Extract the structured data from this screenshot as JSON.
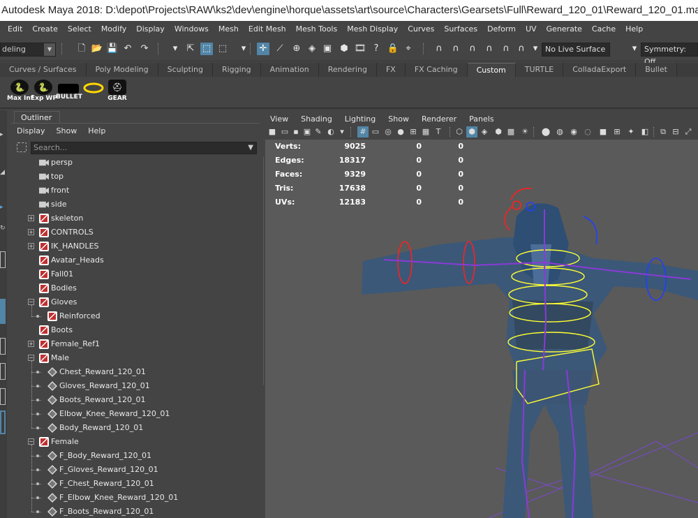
{
  "window": {
    "title": "Autodesk Maya 2018: D:\\depot\\Projects\\RAW\\ks2\\dev\\engine\\horque\\assets\\art\\source\\Characters\\Gearsets\\Full\\Reward_120_01\\Reward_120_01.ma*"
  },
  "menubar": [
    "Edit",
    "Create",
    "Select",
    "Modify",
    "Display",
    "Windows",
    "Mesh",
    "Edit Mesh",
    "Mesh Tools",
    "Mesh Display",
    "Curves",
    "Surfaces",
    "Deform",
    "UV",
    "Generate",
    "Cache",
    "Help"
  ],
  "statusline": {
    "mode": "deling",
    "live_surface": "No Live Surface",
    "symmetry": "Symmetry: Off"
  },
  "shelf_tabs": [
    "Curves / Surfaces",
    "Poly Modeling",
    "Sculpting",
    "Rigging",
    "Animation",
    "Rendering",
    "FX",
    "FX Caching",
    "Custom",
    "TURTLE",
    "ColladaExport",
    "Bullet"
  ],
  "shelf_active": "Custom",
  "shelf_buttons": [
    {
      "label": "Max Inf",
      "icon": "python-icon"
    },
    {
      "label": "Exp WP",
      "icon": "python-icon"
    },
    {
      "label": "BULLET",
      "icon": "bullet-icon"
    },
    {
      "label": "",
      "icon": "halo-icon"
    },
    {
      "label": "GEAR",
      "icon": "gear-helmet-icon"
    }
  ],
  "outliner": {
    "tab": "Outliner",
    "menu": [
      "Display",
      "Show",
      "Help"
    ],
    "search_placeholder": "Search...",
    "items": [
      {
        "label": "persp",
        "type": "camera",
        "depth": 0,
        "expander": ""
      },
      {
        "label": "top",
        "type": "camera",
        "depth": 0,
        "expander": ""
      },
      {
        "label": "front",
        "type": "camera",
        "depth": 0,
        "expander": ""
      },
      {
        "label": "side",
        "type": "camera",
        "depth": 0,
        "expander": ""
      },
      {
        "label": "skeleton",
        "type": "set",
        "depth": 0,
        "expander": "+"
      },
      {
        "label": "CONTROLS",
        "type": "set",
        "depth": 0,
        "expander": "+"
      },
      {
        "label": "IK_HANDLES",
        "type": "set",
        "depth": 0,
        "expander": "+"
      },
      {
        "label": "Avatar_Heads",
        "type": "set",
        "depth": 0,
        "expander": ""
      },
      {
        "label": "Fall01",
        "type": "set",
        "depth": 0,
        "expander": ""
      },
      {
        "label": "Bodies",
        "type": "set",
        "depth": 0,
        "expander": ""
      },
      {
        "label": "Gloves",
        "type": "set",
        "depth": 0,
        "expander": "-"
      },
      {
        "label": "Reinforced",
        "type": "set",
        "depth": 1,
        "expander": ""
      },
      {
        "label": "Boots",
        "type": "set",
        "depth": 0,
        "expander": ""
      },
      {
        "label": "Female_Ref1",
        "type": "set",
        "depth": 0,
        "expander": "+"
      },
      {
        "label": "Male",
        "type": "set",
        "depth": 0,
        "expander": "-"
      },
      {
        "label": "Chest_Reward_120_01",
        "type": "mesh",
        "depth": 1,
        "expander": ""
      },
      {
        "label": "Gloves_Reward_120_01",
        "type": "mesh",
        "depth": 1,
        "expander": ""
      },
      {
        "label": "Boots_Reward_120_01",
        "type": "mesh",
        "depth": 1,
        "expander": ""
      },
      {
        "label": "Elbow_Knee_Reward_120_01",
        "type": "mesh",
        "depth": 1,
        "expander": ""
      },
      {
        "label": "Body_Reward_120_01",
        "type": "mesh",
        "depth": 1,
        "expander": ""
      },
      {
        "label": "Female",
        "type": "set",
        "depth": 0,
        "expander": "-"
      },
      {
        "label": "F_Body_Reward_120_01",
        "type": "mesh",
        "depth": 1,
        "expander": ""
      },
      {
        "label": "F_Gloves_Reward_120_01",
        "type": "mesh",
        "depth": 1,
        "expander": ""
      },
      {
        "label": "F_Chest_Reward_120_01",
        "type": "mesh",
        "depth": 1,
        "expander": ""
      },
      {
        "label": "F_Elbow_Knee_Reward_120_01",
        "type": "mesh",
        "depth": 1,
        "expander": ""
      },
      {
        "label": "F_Boots_Reward_120_01",
        "type": "mesh",
        "depth": 1,
        "expander": ""
      }
    ]
  },
  "viewport": {
    "menu": [
      "View",
      "Shading",
      "Lighting",
      "Show",
      "Renderer",
      "Panels"
    ],
    "hud": [
      {
        "label": "Verts:",
        "v1": "9025",
        "v2": "0",
        "v3": "0"
      },
      {
        "label": "Edges:",
        "v1": "18317",
        "v2": "0",
        "v3": "0"
      },
      {
        "label": "Faces:",
        "v1": "9329",
        "v2": "0",
        "v3": "0"
      },
      {
        "label": "Tris:",
        "v1": "17638",
        "v2": "0",
        "v3": "0"
      },
      {
        "label": "UVs:",
        "v1": "12183",
        "v2": "0",
        "v3": "0"
      }
    ]
  },
  "colors": {
    "selected_icon": "#5285a6",
    "viewport_bg": "#5a5a5a",
    "rig_yellow": "#ffff33",
    "rig_red": "#ff2020",
    "rig_blue": "#2040ff",
    "rig_purple": "#8a3ad8",
    "character_blue": "#3a5a80"
  }
}
